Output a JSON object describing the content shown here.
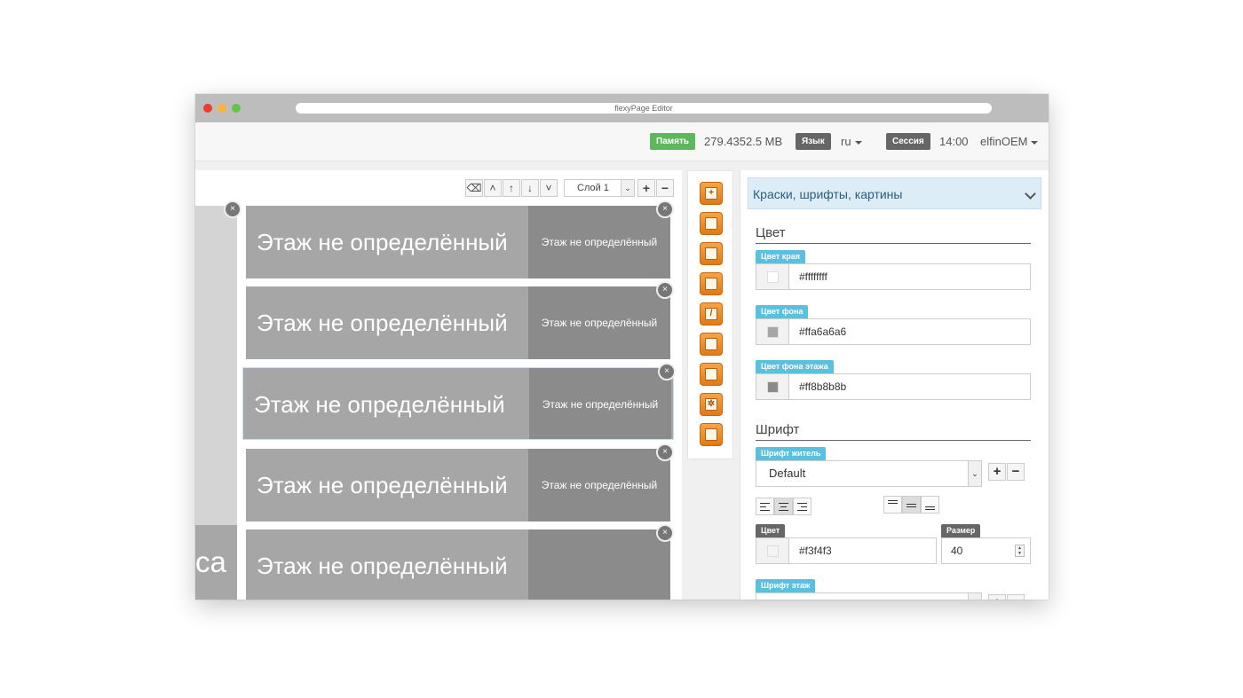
{
  "window": {
    "title": "flexyPage Editor"
  },
  "topbar": {
    "memory_badge": "Память",
    "memory_value": "279.4352.5 MB",
    "language_badge": "Язык",
    "language_value": "ru",
    "session_badge": "Сессия",
    "session_value": "14:00",
    "user": "elfinOEM"
  },
  "canvas": {
    "layer_select": "Слой 1",
    "left_strip_text": "ca",
    "floors": [
      {
        "main": "Этаж не определённый",
        "side": "Этаж не определённый"
      },
      {
        "main": "Этаж не определённый",
        "side": "Этаж не определённый"
      },
      {
        "main": "Этаж не определённый",
        "side": "Этаж не определённый"
      },
      {
        "main": "Этаж не определённый",
        "side": "Этаж не определённый"
      },
      {
        "main": "Этаж не определённый",
        "side": ""
      }
    ]
  },
  "props": {
    "header": "Краски, шрифты, картины",
    "color_section": "Цвет",
    "border_color_label": "Цвет края",
    "border_color_value": "#ffffffff",
    "bg_color_label": "Цвет фона",
    "bg_color_value": "#ffa6a6a6",
    "floor_bg_label": "Цвет фона этажа",
    "floor_bg_value": "#ff8b8b8b",
    "font_section": "Шрифт",
    "font_resident_label": "Шрифт житель",
    "font_resident_value": "Default",
    "font_color_label": "Цвет",
    "font_color_value": "#f3f4f3",
    "size_label": "Размер",
    "size_value": "40",
    "font_floor_label": "Шрифт этаж"
  },
  "colors": {
    "accent_green": "#5cb85c",
    "label_blue": "#5bc0de",
    "floor_bg": "#a6a6a6",
    "floor_side": "#8b8b8b"
  },
  "icons": [
    "eraser-icon",
    "chevron-up-icon",
    "arrow-up-icon",
    "arrow-down-icon",
    "chevron-down-icon",
    "plus-icon",
    "minus-icon",
    "close-circle-icon"
  ]
}
